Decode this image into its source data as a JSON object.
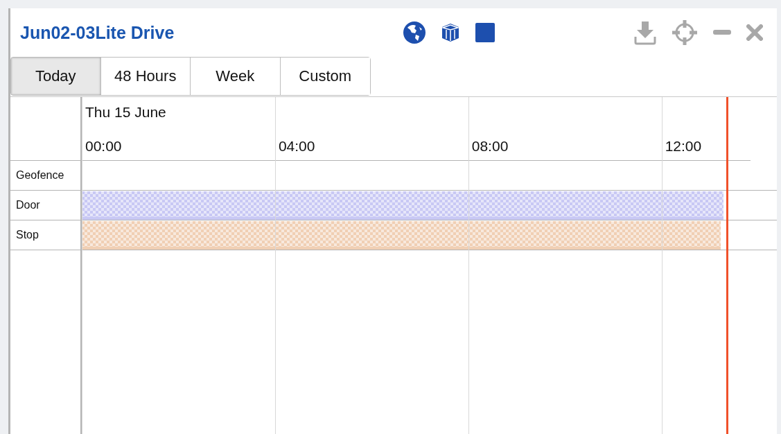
{
  "window": {
    "title": "Jun02-03Lite Drive"
  },
  "tabs": [
    {
      "label": "Today",
      "selected": true
    },
    {
      "label": "48 Hours",
      "selected": false
    },
    {
      "label": "Week",
      "selected": false
    },
    {
      "label": "Custom",
      "selected": false
    }
  ],
  "timeline": {
    "date": "Thu 15 June",
    "ticks": [
      "00:00",
      "04:00",
      "08:00",
      "12:00"
    ],
    "rows": [
      {
        "label": "Geofence"
      },
      {
        "label": "Door",
        "bar": {
          "level": 0.96,
          "color": "#c8c8f4"
        }
      },
      {
        "label": "Stop",
        "bar": {
          "level": 0.955,
          "color": "#f0cfb4"
        }
      }
    ]
  }
}
